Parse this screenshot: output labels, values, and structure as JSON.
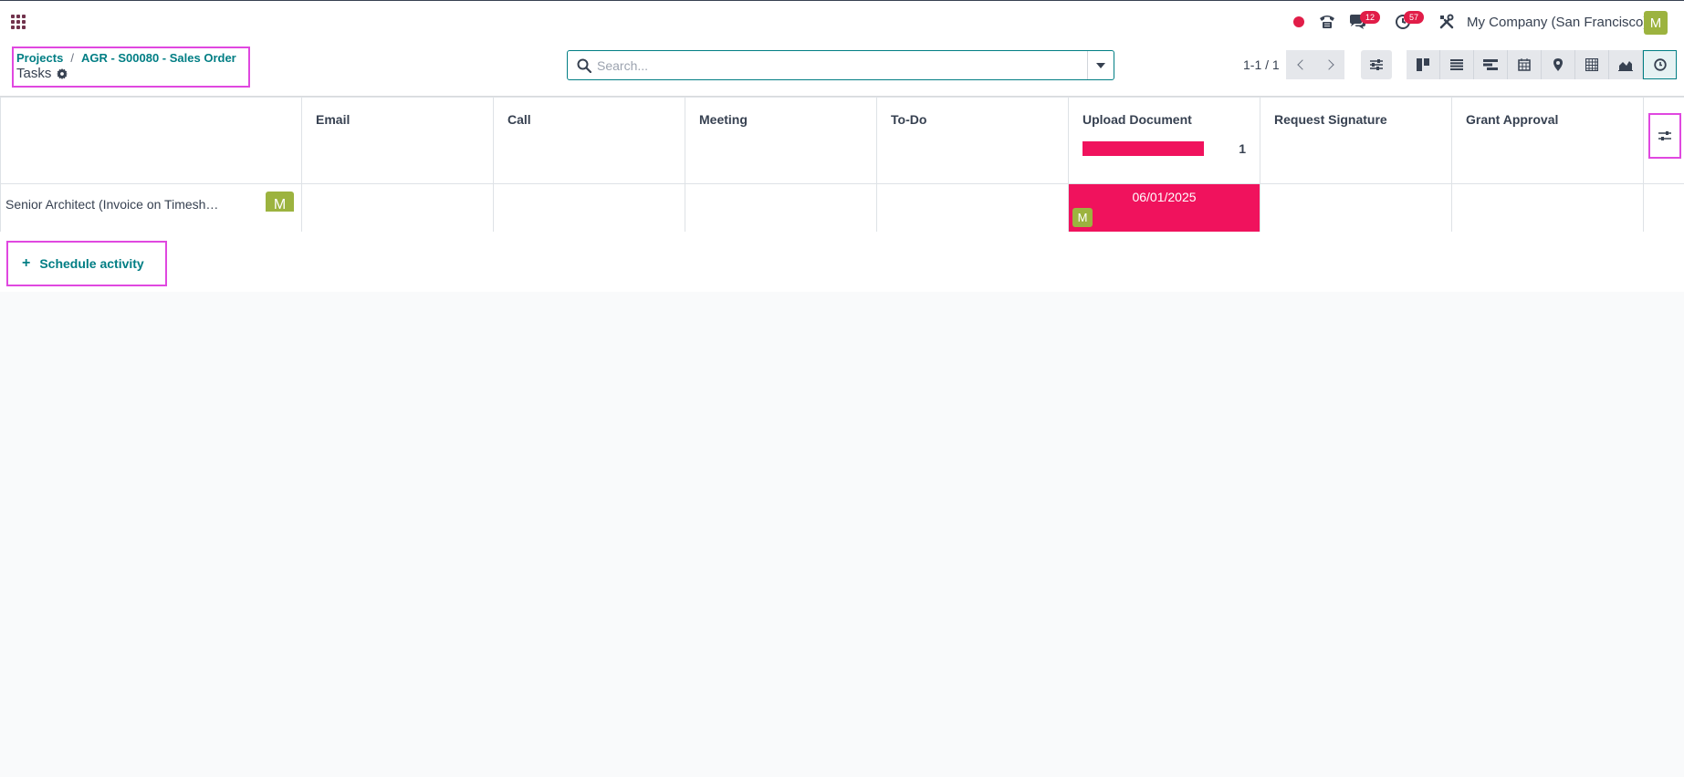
{
  "navbar": {
    "messages_badge": "12",
    "activities_badge": "57",
    "company": "My Company (San Francisco)",
    "user_initial": "M"
  },
  "breadcrumb": {
    "root": "Projects",
    "parent": "AGR - S00080 - Sales Order",
    "separator": "/",
    "current": "Tasks"
  },
  "search": {
    "placeholder": "Search...",
    "value": ""
  },
  "pager": {
    "text": "1-1 / 1"
  },
  "grid": {
    "columns": [
      "Email",
      "Call",
      "Meeting",
      "To-Do",
      "Upload Document",
      "Request Signature",
      "Grant Approval"
    ],
    "upload_document_progress": {
      "count": "1",
      "overdue_fraction": 1.0,
      "color": "#f0125d"
    },
    "rows": [
      {
        "name": "Senior Architect (Invoice on Timesh…",
        "avatar": "M",
        "upload_document_date": "06/01/2025",
        "upload_document_avatar": "M"
      }
    ]
  },
  "actions": {
    "schedule_activity": "Schedule activity",
    "plus": "+"
  },
  "colors": {
    "accent": "#017e84",
    "overdue": "#f0125d",
    "avatar": "#9cb33f",
    "highlight": "#e048e0"
  }
}
